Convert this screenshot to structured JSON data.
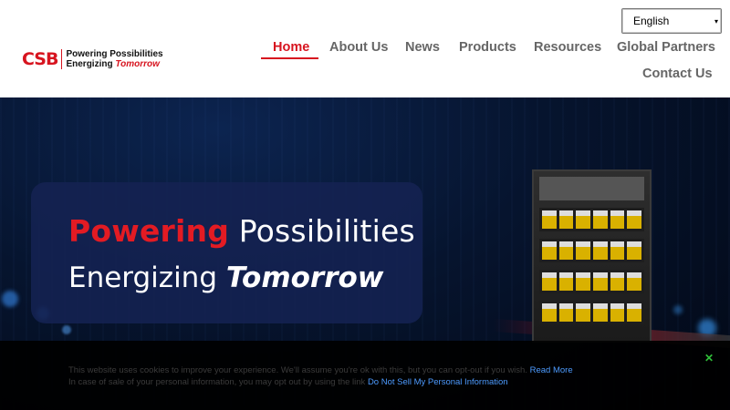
{
  "brand": {
    "logo_text": "CSB",
    "tagline_line1": "Powering Possibilities",
    "tagline_line2_prefix": "Energizing ",
    "tagline_line2_emph": "Tomorrow",
    "accent_color": "#d7141f"
  },
  "language_select": {
    "selected": "English"
  },
  "nav": {
    "items": [
      {
        "label": "Home",
        "active": true
      },
      {
        "label": "About Us"
      },
      {
        "label": "News"
      },
      {
        "label": "Products"
      },
      {
        "label": "Resources"
      },
      {
        "label": "Global Partners"
      },
      {
        "label": "Contact Us"
      }
    ]
  },
  "hero": {
    "line1_red": "Powering",
    "line1_rest": " Possibilities",
    "line2_prefix": "Energizing ",
    "line2_emph": "Tomorrow"
  },
  "cookie_bar": {
    "line1_text": "This website uses cookies to improve your experience. We'll assume you're ok with this, but you can opt-out if you wish. ",
    "read_more": "Read More",
    "line2_text": "In case of sale of your personal information, you may opt out by using the link ",
    "do_not_sell": "Do Not Sell My Personal Information",
    "close_glyph": "✕",
    "link_color": "#4d9bff",
    "close_color": "#2fbf3a"
  }
}
